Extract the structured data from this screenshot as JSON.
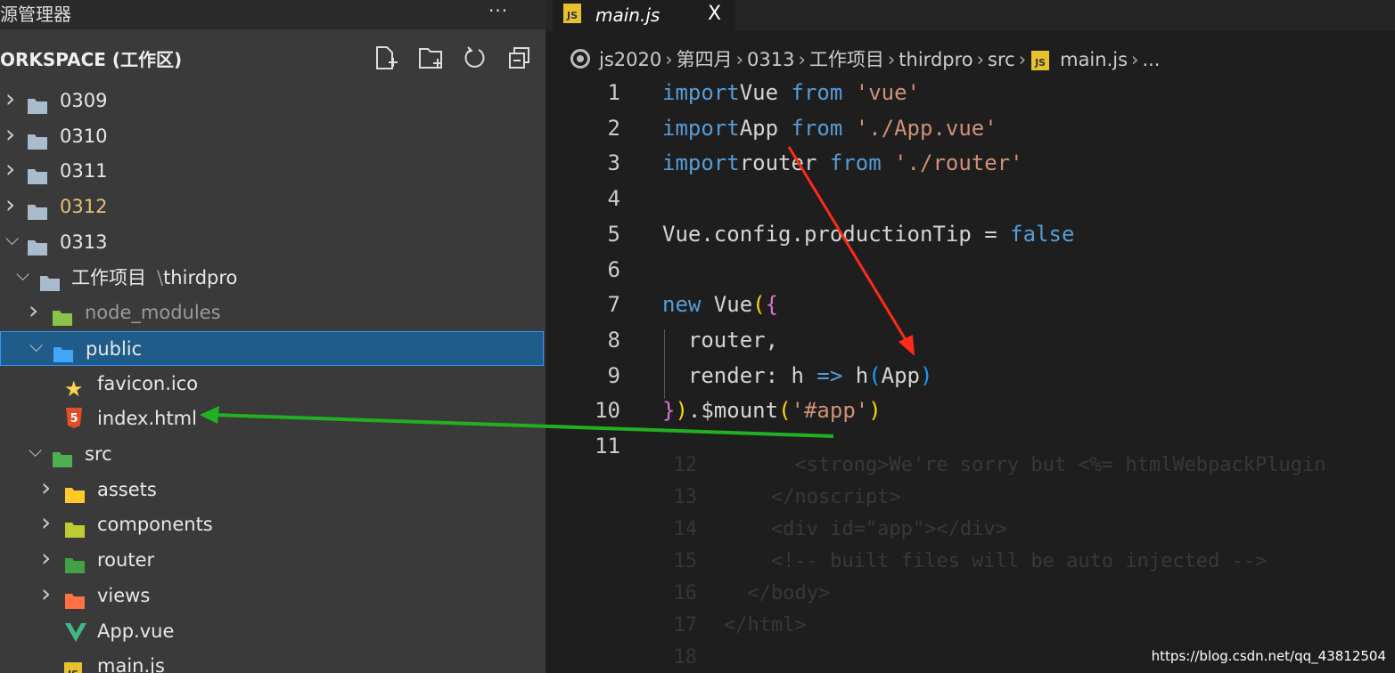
{
  "explorer": {
    "title": "源管理器",
    "more": "···",
    "workspace": "ORKSPACE (工作区)",
    "actions": [
      "new-file-icon",
      "new-folder-icon",
      "refresh-icon",
      "collapse-all-icon"
    ],
    "tree": [
      {
        "label": "0309",
        "level": 0,
        "type": "folder",
        "expanded": false
      },
      {
        "label": "0310",
        "level": 0,
        "type": "folder",
        "expanded": false
      },
      {
        "label": "0311",
        "level": 0,
        "type": "folder",
        "expanded": false
      },
      {
        "label": "0312",
        "level": 0,
        "type": "folder",
        "expanded": false,
        "modified": true
      },
      {
        "label": "0313",
        "level": 0,
        "type": "folder",
        "expanded": true
      },
      {
        "label": "工作项目",
        "label_suffix": "thirdpro",
        "level": 1,
        "type": "folder",
        "expanded": true
      },
      {
        "label": "node_modules",
        "level": 2,
        "type": "folder-node",
        "expanded": false
      },
      {
        "label": "public",
        "level": 2,
        "type": "folder-public",
        "expanded": true,
        "selected": true
      },
      {
        "label": "favicon.ico",
        "level": 3,
        "type": "favicon"
      },
      {
        "label": "index.html",
        "level": 3,
        "type": "html"
      },
      {
        "label": "src",
        "level": 2,
        "type": "folder-src",
        "expanded": true
      },
      {
        "label": "assets",
        "level": 3,
        "type": "folder-assets",
        "expanded": false
      },
      {
        "label": "components",
        "level": 3,
        "type": "folder-components",
        "expanded": false
      },
      {
        "label": "router",
        "level": 3,
        "type": "folder-router",
        "expanded": false
      },
      {
        "label": "views",
        "level": 3,
        "type": "folder-views",
        "expanded": false
      },
      {
        "label": "App.vue",
        "level": 3,
        "type": "vue"
      },
      {
        "label": "main.js",
        "level": 3,
        "type": "js"
      }
    ]
  },
  "editor": {
    "tab": {
      "label": "main.js",
      "icon": "JS",
      "close": "X"
    },
    "breadcrumb": [
      "js2020",
      "第四月",
      "0313",
      "工作项目",
      "thirdpro",
      "src",
      "main.js",
      "..."
    ],
    "lines": [
      {
        "n": "1",
        "tokens": [
          [
            "kw",
            "import"
          ],
          [
            "",
            "Vue "
          ],
          [
            "kw",
            "from "
          ],
          [
            "str",
            "'vue'"
          ]
        ]
      },
      {
        "n": "2",
        "tokens": [
          [
            "kw",
            "import"
          ],
          [
            "",
            "App "
          ],
          [
            "kw",
            "from "
          ],
          [
            "str",
            "'./App.vue'"
          ]
        ]
      },
      {
        "n": "3",
        "tokens": [
          [
            "kw",
            "import"
          ],
          [
            "",
            "router "
          ],
          [
            "kw",
            "from "
          ],
          [
            "str",
            "'./router'"
          ]
        ]
      },
      {
        "n": "4",
        "tokens": []
      },
      {
        "n": "5",
        "tokens": [
          [
            "",
            "Vue.config.productionTip = "
          ],
          [
            "kw",
            "false"
          ]
        ]
      },
      {
        "n": "6",
        "tokens": []
      },
      {
        "n": "7",
        "tokens": [
          [
            "kw",
            "new "
          ],
          [
            "",
            "Vue"
          ],
          [
            "br1",
            "("
          ],
          [
            "br2",
            "{"
          ]
        ]
      },
      {
        "n": "8",
        "tokens": [
          [
            "",
            "  router,"
          ]
        ]
      },
      {
        "n": "9",
        "tokens": [
          [
            "",
            "  render: h "
          ],
          [
            "kw",
            "=>"
          ],
          [
            "",
            " h"
          ],
          [
            "br3",
            "("
          ],
          [
            "",
            "App"
          ],
          [
            "br3",
            ")"
          ]
        ]
      },
      {
        "n": "10",
        "tokens": [
          [
            "br2",
            "}"
          ],
          [
            "br1",
            ")"
          ],
          [
            "",
            ".$mount"
          ],
          [
            "br1",
            "("
          ],
          [
            "str",
            "'#app'"
          ],
          [
            "br1",
            ")"
          ]
        ]
      },
      {
        "n": "11",
        "tokens": []
      }
    ],
    "ghost_lines": [
      {
        "n": "12",
        "text": "      <strong>We're sorry but <%= htmlWebpackPlugin"
      },
      {
        "n": "13",
        "text": "    </noscript>"
      },
      {
        "n": "14",
        "text": "    <div id=\"app\"></div>"
      },
      {
        "n": "15",
        "text": "    <!-- built files will be auto injected -->"
      },
      {
        "n": "16",
        "text": "  </body>"
      },
      {
        "n": "17",
        "text": "</html>"
      },
      {
        "n": "18",
        "text": ""
      }
    ]
  },
  "annotations": {
    "red_arrow": "#ff2a1a",
    "green_arrow": "#22b022"
  },
  "watermark": "https://blog.csdn.net/qq_43812504"
}
